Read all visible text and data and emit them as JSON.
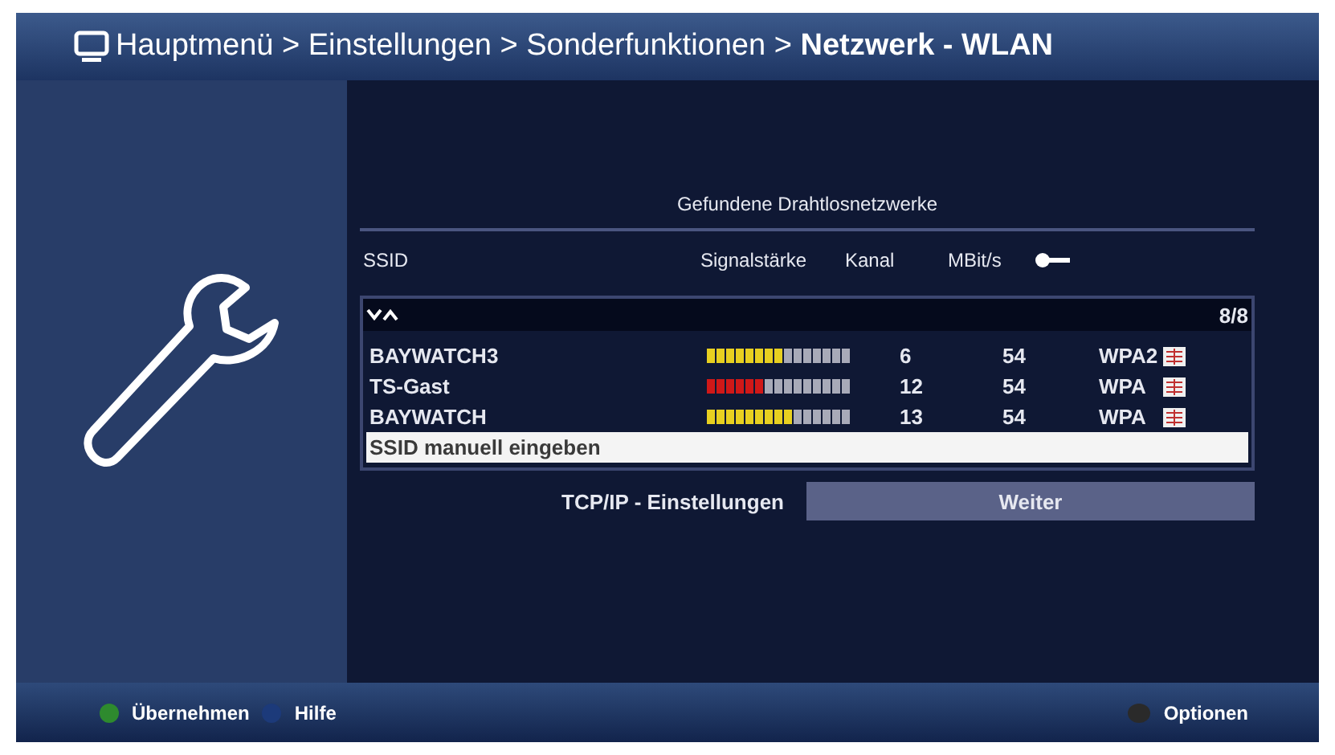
{
  "header": {
    "breadcrumb": "Hauptmenü > Einstellungen > Sonderfunktionen > **Netzwerk - WLAN**"
  },
  "panel": {
    "title": "Gefundene Drahtlosnetzwerke",
    "columns": [
      "SSID",
      "Signalstärke",
      "Kanal",
      "MBit/s"
    ],
    "page": "8/8",
    "rows": [
      {
        "kind": "network",
        "ssid": "BAYWATCH3",
        "level": 0.53,
        "color": "#e8d020",
        "channel": "6",
        "rate": "54",
        "security": "WPA2",
        "selected": false
      },
      {
        "kind": "network",
        "ssid": "TS-Gast",
        "level": 0.4,
        "color": "#d01818",
        "channel": "12",
        "rate": "54",
        "security": "WPA",
        "selected": false
      },
      {
        "kind": "network",
        "ssid": "BAYWATCH",
        "level": 0.6,
        "color": "#e8d020",
        "channel": "13",
        "rate": "54",
        "security": "WPA",
        "selected": false
      },
      {
        "kind": "action",
        "label": "SSID manuell eingeben",
        "selected": true
      }
    ],
    "setting": {
      "label": "TCP/IP - Einstellungen",
      "value": "Weiter"
    }
  },
  "footer": {
    "left": [
      {
        "label": "Übernehmen",
        "color": "#2e8a2e"
      },
      {
        "label": "Hilfe",
        "color": "#1c3a7a"
      }
    ],
    "right": "Optionen"
  }
}
